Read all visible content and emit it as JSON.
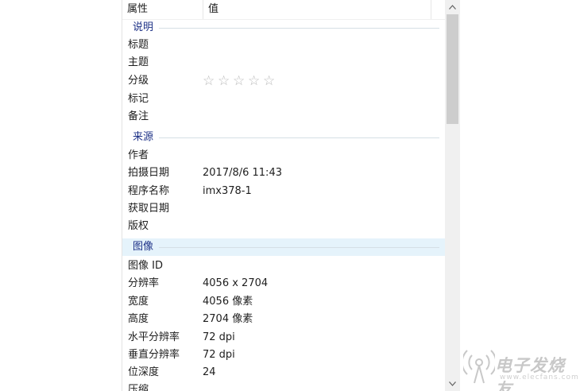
{
  "header": {
    "property_label": "属性",
    "value_label": "值"
  },
  "groups": [
    {
      "title": "说明",
      "rows": [
        {
          "name": "标题",
          "value": ""
        },
        {
          "name": "主题",
          "value": ""
        },
        {
          "name": "分级",
          "value": "",
          "rating": {
            "stars_filled": 0,
            "stars_total": 5
          }
        },
        {
          "name": "标记",
          "value": ""
        },
        {
          "name": "备注",
          "value": ""
        }
      ]
    },
    {
      "title": "来源",
      "rows": [
        {
          "name": "作者",
          "value": ""
        },
        {
          "name": "拍摄日期",
          "value": "2017/8/6 11:43"
        },
        {
          "name": "程序名称",
          "value": "imx378-1"
        },
        {
          "name": "获取日期",
          "value": ""
        },
        {
          "name": "版权",
          "value": ""
        }
      ]
    },
    {
      "title": "图像",
      "selected": true,
      "rows": [
        {
          "name": "图像 ID",
          "value": ""
        },
        {
          "name": "分辨率",
          "value": "4056 x 2704"
        },
        {
          "name": "宽度",
          "value": "4056 像素"
        },
        {
          "name": "高度",
          "value": "2704 像素"
        },
        {
          "name": "水平分辨率",
          "value": "72 dpi"
        },
        {
          "name": "垂直分辨率",
          "value": "72 dpi"
        },
        {
          "name": "位深度",
          "value": "24"
        },
        {
          "name": "压缩",
          "value": ""
        }
      ]
    }
  ],
  "scrollbar": {
    "up_icon": "chevron-up-icon",
    "down_icon": "chevron-down-icon"
  },
  "watermark": {
    "text": "电子发烧友",
    "sub": "www.elecfans.com",
    "icon": "radio-tower-icon"
  },
  "colors": {
    "group_title": "#1e3287",
    "selected_group_bg": "#e5f3fb",
    "star": "#b9b9b9"
  }
}
